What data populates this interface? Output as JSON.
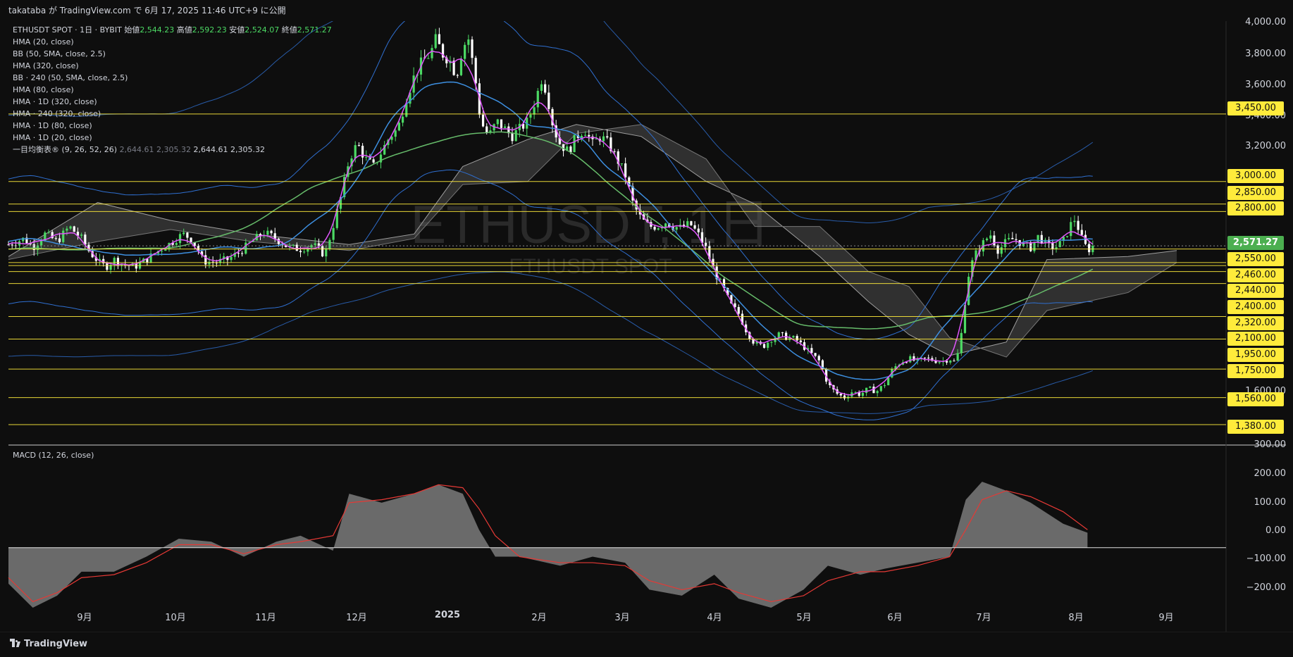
{
  "header": {
    "publish_text": "takataba が TradingView.com で 6月 17, 2025 11:46 UTC+9 に公開"
  },
  "watermark": {
    "line1": "ETHUSDT, 1日",
    "line2": "ETHUSDT SPOT"
  },
  "legend": {
    "symbol": "ETHUSDT SPOT · 1日 · BYBIT",
    "open_label": "始値",
    "open": "2,544.23",
    "high_label": "高値",
    "high": "2,592.23",
    "low_label": "安値",
    "low": "2,524.07",
    "close_label": "終値",
    "close": "2,571.27",
    "indicators": [
      "HMA (20, close)",
      "BB (50, SMA, close, 2.5)",
      "HMA (320, close)",
      "BB · 240 (50, SMA, close, 2.5)",
      "HMA (80, close)",
      "HMA · 1D (320, close)",
      "HMA · 240 (320, close)",
      "HMA · 1D (80, close)",
      "HMA · 1D (20, close)"
    ],
    "ichimoku_label": "一目均衡表® (9, 26, 52, 26)",
    "ichimoku_values": [
      "2,644.61",
      "2,305.32",
      "2,644.61",
      "2,305.32"
    ]
  },
  "macd_label": "MACD (12, 26, close)",
  "price_axis": {
    "ticks": [
      "4,000.00",
      "3,800.00",
      "3,600.00",
      "3,400.00",
      "3,200.00",
      "1,600.00",
      "300.00"
    ],
    "yellow_levels": [
      "3,450.00",
      "3,000.00",
      "2,850.00",
      "2,800.00",
      "2,550.00",
      "2,460.00",
      "2,440.00",
      "2,400.00",
      "2,320.00",
      "2,100.00",
      "1,950.00",
      "1,750.00",
      "1,560.00",
      "1,380.00"
    ],
    "current_price": "2,571.27"
  },
  "macd_axis": {
    "ticks": [
      "200.00",
      "100.00",
      "0.00",
      "−100.00",
      "−200.00"
    ]
  },
  "x_axis": {
    "labels": [
      "9月",
      "10月",
      "11月",
      "12月",
      "2025",
      "2月",
      "3月",
      "4月",
      "5月",
      "6月",
      "7月",
      "8月",
      "9月"
    ]
  },
  "footer": {
    "brand": "TradingView"
  },
  "colors": {
    "background": "#0e0e0e",
    "up": "#4cd964",
    "down": "#ffffff",
    "hma20": "#e056fd",
    "hma_blue": "#3d8fe0",
    "hma_green": "#66bb6a",
    "bb_band": "#2f6fd0",
    "cloud": "#5a5a5a",
    "yellow_line": "#ffeb3b",
    "macd_signal": "#e53935",
    "macd_hist": "#8a8a8a"
  },
  "chart_data": {
    "type": "candlestick",
    "title": "ETHUSDT, 1日",
    "symbol": "ETHUSDT SPOT",
    "exchange": "BYBIT",
    "timeframe": "1日",
    "period_start": "2024-08",
    "period_end": "2025-06-17",
    "ylim": [
      1300,
      4050
    ],
    "last": {
      "open": 2544.23,
      "high": 2592.23,
      "low": 2524.07,
      "close": 2571.27
    },
    "horizontal_levels": [
      3450,
      3000,
      2850,
      2800,
      2550,
      2460,
      2440,
      2400,
      2320,
      2100,
      1950,
      1750,
      1560,
      1380
    ],
    "price_path": [
      [
        0,
        2580
      ],
      [
        20,
        2620
      ],
      [
        30,
        2560
      ],
      [
        45,
        2650
      ],
      [
        60,
        2600
      ],
      [
        75,
        2700
      ],
      [
        90,
        2620
      ],
      [
        100,
        2530
      ],
      [
        112,
        2460
      ],
      [
        120,
        2430
      ],
      [
        130,
        2480
      ],
      [
        140,
        2450
      ],
      [
        155,
        2430
      ],
      [
        170,
        2480
      ],
      [
        185,
        2540
      ],
      [
        200,
        2590
      ],
      [
        215,
        2650
      ],
      [
        225,
        2620
      ],
      [
        232,
        2560
      ],
      [
        240,
        2470
      ],
      [
        255,
        2460
      ],
      [
        270,
        2480
      ],
      [
        285,
        2530
      ],
      [
        300,
        2600
      ],
      [
        315,
        2660
      ],
      [
        330,
        2620
      ],
      [
        345,
        2560
      ],
      [
        360,
        2550
      ],
      [
        375,
        2580
      ],
      [
        390,
        2510
      ],
      [
        400,
        2700
      ],
      [
        410,
        2900
      ],
      [
        420,
        3150
      ],
      [
        430,
        3250
      ],
      [
        440,
        3150
      ],
      [
        450,
        3100
      ],
      [
        460,
        3200
      ],
      [
        470,
        3300
      ],
      [
        480,
        3350
      ],
      [
        490,
        3550
      ],
      [
        500,
        3700
      ],
      [
        510,
        3800
      ],
      [
        520,
        3850
      ],
      [
        527,
        3950
      ],
      [
        535,
        3850
      ],
      [
        545,
        3800
      ],
      [
        552,
        3700
      ],
      [
        560,
        3900
      ],
      [
        567,
        3950
      ],
      [
        575,
        3700
      ],
      [
        582,
        3400
      ],
      [
        592,
        3300
      ],
      [
        602,
        3400
      ],
      [
        612,
        3350
      ],
      [
        620,
        3300
      ],
      [
        630,
        3350
      ],
      [
        640,
        3400
      ],
      [
        650,
        3550
      ],
      [
        658,
        3700
      ],
      [
        665,
        3550
      ],
      [
        672,
        3350
      ],
      [
        680,
        3250
      ],
      [
        690,
        3200
      ],
      [
        700,
        3300
      ],
      [
        710,
        3350
      ],
      [
        720,
        3250
      ],
      [
        730,
        3300
      ],
      [
        740,
        3250
      ],
      [
        750,
        3150
      ],
      [
        760,
        3050
      ],
      [
        770,
        2850
      ],
      [
        780,
        2750
      ],
      [
        790,
        2700
      ],
      [
        800,
        2700
      ],
      [
        810,
        2730
      ],
      [
        820,
        2700
      ],
      [
        830,
        2690
      ],
      [
        840,
        2720
      ],
      [
        850,
        2650
      ],
      [
        860,
        2550
      ],
      [
        870,
        2400
      ],
      [
        880,
        2300
      ],
      [
        890,
        2180
      ],
      [
        900,
        2120
      ],
      [
        910,
        2000
      ],
      [
        920,
        1920
      ],
      [
        930,
        1900
      ],
      [
        940,
        1950
      ],
      [
        950,
        1980
      ],
      [
        960,
        1960
      ],
      [
        970,
        1950
      ],
      [
        980,
        1900
      ],
      [
        990,
        1850
      ],
      [
        1000,
        1800
      ],
      [
        1010,
        1650
      ],
      [
        1020,
        1590
      ],
      [
        1030,
        1560
      ],
      [
        1040,
        1600
      ],
      [
        1050,
        1580
      ],
      [
        1060,
        1620
      ],
      [
        1070,
        1600
      ],
      [
        1080,
        1650
      ],
      [
        1090,
        1750
      ],
      [
        1100,
        1800
      ],
      [
        1110,
        1820
      ],
      [
        1120,
        1800
      ],
      [
        1130,
        1820
      ],
      [
        1140,
        1810
      ],
      [
        1150,
        1800
      ],
      [
        1160,
        1820
      ],
      [
        1168,
        1790
      ],
      [
        1175,
        2000
      ],
      [
        1182,
        2350
      ],
      [
        1190,
        2500
      ],
      [
        1200,
        2580
      ],
      [
        1210,
        2650
      ],
      [
        1220,
        2540
      ],
      [
        1230,
        2600
      ],
      [
        1240,
        2620
      ],
      [
        1250,
        2580
      ],
      [
        1260,
        2560
      ],
      [
        1270,
        2640
      ],
      [
        1280,
        2570
      ],
      [
        1290,
        2560
      ],
      [
        1300,
        2600
      ],
      [
        1310,
        2720
      ],
      [
        1316,
        2760
      ],
      [
        1320,
        2650
      ],
      [
        1325,
        2600
      ],
      [
        1330,
        2540
      ],
      [
        1337,
        2571
      ]
    ],
    "ichimoku": {
      "span_a": [
        [
          0,
          2500
        ],
        [
          110,
          2860
        ],
        [
          200,
          2740
        ],
        [
          300,
          2650
        ],
        [
          420,
          2580
        ],
        [
          500,
          2650
        ],
        [
          560,
          3100
        ],
        [
          640,
          3280
        ],
        [
          700,
          3380
        ],
        [
          780,
          3300
        ],
        [
          860,
          3000
        ],
        [
          920,
          2850
        ],
        [
          1000,
          2500
        ],
        [
          1060,
          2200
        ],
        [
          1110,
          1980
        ],
        [
          1160,
          1840
        ],
        [
          1230,
          1930
        ],
        [
          1280,
          2480
        ],
        [
          1380,
          2500
        ],
        [
          1440,
          2540
        ]
      ],
      "span_b": [
        [
          0,
          2480
        ],
        [
          110,
          2600
        ],
        [
          200,
          2680
        ],
        [
          300,
          2600
        ],
        [
          420,
          2540
        ],
        [
          500,
          2620
        ],
        [
          560,
          2980
        ],
        [
          640,
          3000
        ],
        [
          700,
          3320
        ],
        [
          780,
          3380
        ],
        [
          860,
          3150
        ],
        [
          920,
          2700
        ],
        [
          1000,
          2700
        ],
        [
          1060,
          2400
        ],
        [
          1110,
          2300
        ],
        [
          1160,
          1960
        ],
        [
          1230,
          1830
        ],
        [
          1280,
          2140
        ],
        [
          1380,
          2260
        ],
        [
          1440,
          2460
        ]
      ]
    },
    "hma_lines": {
      "hma20_pink": "tracks price closely",
      "hma80_blue": "smoothed trend",
      "hma320_green": "long-term trend"
    },
    "macd": {
      "ylim": [
        -240,
        300
      ],
      "hist": [
        [
          0,
          -120
        ],
        [
          30,
          -200
        ],
        [
          60,
          -160
        ],
        [
          90,
          -80
        ],
        [
          130,
          -80
        ],
        [
          170,
          -30
        ],
        [
          210,
          30
        ],
        [
          250,
          20
        ],
        [
          290,
          -30
        ],
        [
          330,
          20
        ],
        [
          360,
          40
        ],
        [
          400,
          -10
        ],
        [
          420,
          180
        ],
        [
          460,
          150
        ],
        [
          500,
          180
        ],
        [
          530,
          210
        ],
        [
          560,
          180
        ],
        [
          580,
          60
        ],
        [
          600,
          -30
        ],
        [
          630,
          -30
        ],
        [
          680,
          -60
        ],
        [
          720,
          -30
        ],
        [
          760,
          -50
        ],
        [
          790,
          -140
        ],
        [
          830,
          -160
        ],
        [
          870,
          -90
        ],
        [
          900,
          -170
        ],
        [
          940,
          -200
        ],
        [
          980,
          -140
        ],
        [
          1010,
          -60
        ],
        [
          1050,
          -90
        ],
        [
          1080,
          -70
        ],
        [
          1120,
          -50
        ],
        [
          1160,
          -30
        ],
        [
          1180,
          160
        ],
        [
          1200,
          220
        ],
        [
          1230,
          190
        ],
        [
          1260,
          150
        ],
        [
          1300,
          80
        ],
        [
          1330,
          50
        ]
      ],
      "signal": [
        [
          0,
          -100
        ],
        [
          30,
          -180
        ],
        [
          60,
          -150
        ],
        [
          90,
          -100
        ],
        [
          130,
          -90
        ],
        [
          170,
          -50
        ],
        [
          210,
          10
        ],
        [
          250,
          10
        ],
        [
          290,
          -20
        ],
        [
          330,
          10
        ],
        [
          360,
          20
        ],
        [
          400,
          40
        ],
        [
          420,
          150
        ],
        [
          460,
          160
        ],
        [
          500,
          180
        ],
        [
          530,
          210
        ],
        [
          560,
          200
        ],
        [
          580,
          130
        ],
        [
          600,
          40
        ],
        [
          630,
          -30
        ],
        [
          680,
          -50
        ],
        [
          720,
          -50
        ],
        [
          760,
          -60
        ],
        [
          790,
          -110
        ],
        [
          830,
          -140
        ],
        [
          870,
          -120
        ],
        [
          900,
          -150
        ],
        [
          940,
          -180
        ],
        [
          980,
          -160
        ],
        [
          1010,
          -110
        ],
        [
          1050,
          -80
        ],
        [
          1080,
          -80
        ],
        [
          1120,
          -60
        ],
        [
          1160,
          -30
        ],
        [
          1180,
          60
        ],
        [
          1200,
          160
        ],
        [
          1230,
          190
        ],
        [
          1260,
          170
        ],
        [
          1300,
          120
        ],
        [
          1330,
          60
        ]
      ]
    }
  }
}
